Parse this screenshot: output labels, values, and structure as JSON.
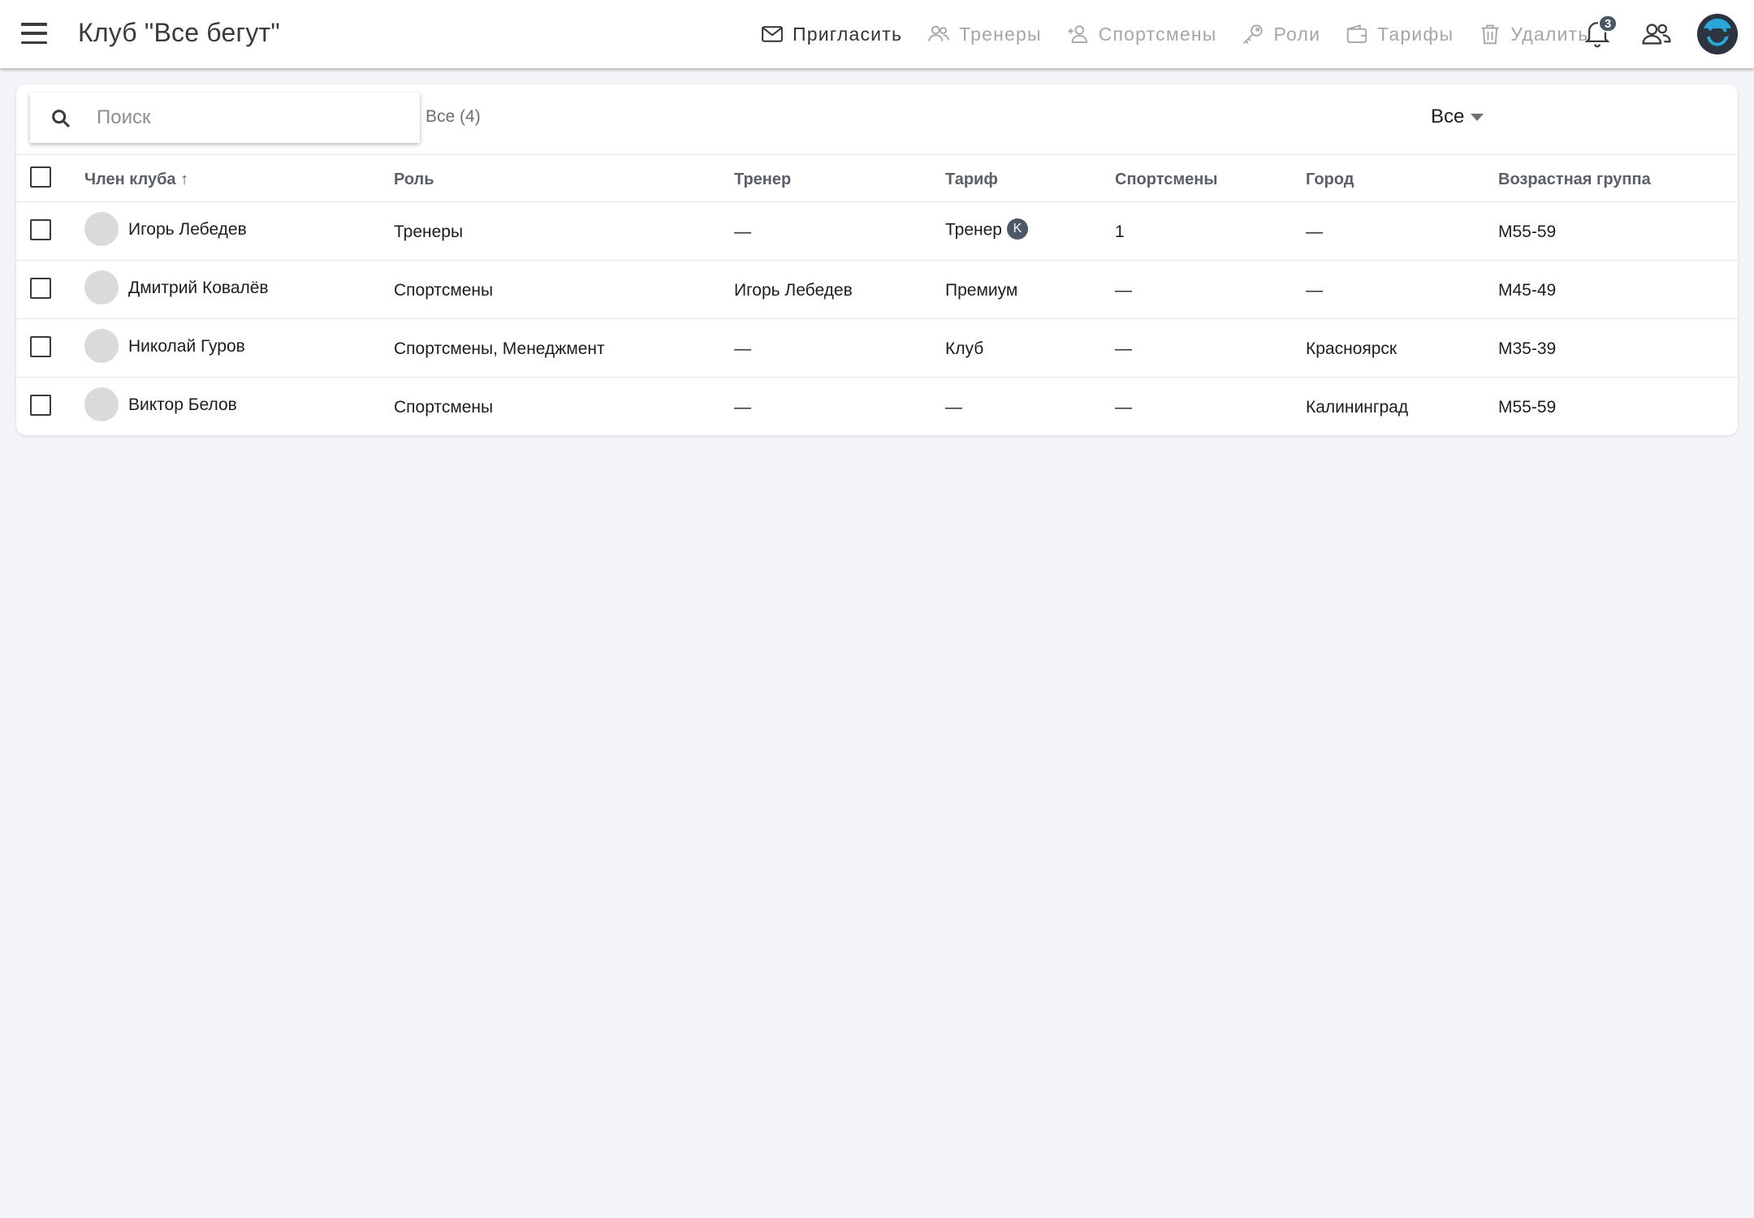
{
  "header": {
    "title": "Клуб \"Все бегут\"",
    "actions": [
      {
        "label": "Пригласить",
        "icon": "envelope-icon",
        "active": true
      },
      {
        "label": "Тренеры",
        "icon": "coaches-icon",
        "active": false
      },
      {
        "label": "Спортсмены",
        "icon": "add-athlete-icon",
        "active": false
      },
      {
        "label": "Роли",
        "icon": "key-icon",
        "active": false
      },
      {
        "label": "Тарифы",
        "icon": "wallet-icon",
        "active": false
      },
      {
        "label": "Удалить",
        "icon": "trash-icon",
        "active": false
      }
    ],
    "notifications_count": "3"
  },
  "toolbar": {
    "search_placeholder": "Поиск",
    "count_label": "Все (4)",
    "filter_value": "Все"
  },
  "table": {
    "columns": [
      "Член клуба ↑",
      "Роль",
      "Тренер",
      "Тариф",
      "Спортсмены",
      "Город",
      "Возрастная группа"
    ],
    "rows": [
      {
        "name": "Игорь Лебедев",
        "role": "Тренеры",
        "coach": "—",
        "tariff": "Тренер",
        "tariff_badge": "K",
        "athletes": "1",
        "city": "—",
        "age_group": "M55-59"
      },
      {
        "name": "Дмитрий Ковалёв",
        "role": "Спортсмены",
        "coach": "Игорь Лебедев",
        "tariff": "Премиум",
        "tariff_badge": "",
        "athletes": "—",
        "city": "—",
        "age_group": "M45-49"
      },
      {
        "name": "Николай Гуров",
        "role": "Спортсмены, Менеджмент",
        "coach": "—",
        "tariff": "Клуб",
        "tariff_badge": "",
        "athletes": "—",
        "city": "Красноярск",
        "age_group": "M35-39"
      },
      {
        "name": "Виктор Белов",
        "role": "Спортсмены",
        "coach": "—",
        "tariff": "—",
        "tariff_badge": "",
        "athletes": "—",
        "city": "Калининград",
        "age_group": "M55-59"
      }
    ]
  },
  "colors": {
    "background": "#f3f4f7",
    "active_text": "#303236",
    "inactive_text": "#a3a6ab",
    "badge": "#4a5662",
    "avatar_accent": "#29a8d8"
  }
}
